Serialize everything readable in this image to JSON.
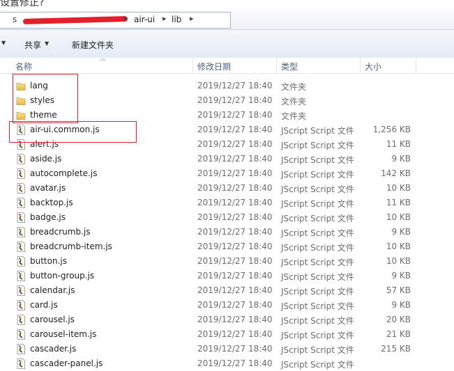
{
  "caption_partial": "设置修正?",
  "address": {
    "crumbs": [
      "air-ui",
      "lib"
    ],
    "separator": "▸"
  },
  "toolbar": {
    "share_label": "共享",
    "new_folder_label": "新建文件夹"
  },
  "columns": {
    "name": "名称",
    "date": "修改日期",
    "type": "类型",
    "size": "大小"
  },
  "files": [
    {
      "name": "lang",
      "date": "2019/12/27 18:40",
      "type": "文件夹",
      "size": "",
      "icon": "folder-icon"
    },
    {
      "name": "styles",
      "date": "2019/12/27 18:40",
      "type": "文件夹",
      "size": "",
      "icon": "folder-icon"
    },
    {
      "name": "theme",
      "date": "2019/12/27 18:40",
      "type": "文件夹",
      "size": "",
      "icon": "folder-icon"
    },
    {
      "name": "air-ui.common.js",
      "date": "2019/12/27 18:40",
      "type": "JScript Script 文件",
      "size": "1,256 KB",
      "icon": "jscript-file-icon"
    },
    {
      "name": "alert.js",
      "date": "2019/12/27 18:40",
      "type": "JScript Script 文件",
      "size": "11 KB",
      "icon": "jscript-file-icon"
    },
    {
      "name": "aside.js",
      "date": "2019/12/27 18:40",
      "type": "JScript Script 文件",
      "size": "9 KB",
      "icon": "jscript-file-icon"
    },
    {
      "name": "autocomplete.js",
      "date": "2019/12/27 18:40",
      "type": "JScript Script 文件",
      "size": "142 KB",
      "icon": "jscript-file-icon"
    },
    {
      "name": "avatar.js",
      "date": "2019/12/27 18:40",
      "type": "JScript Script 文件",
      "size": "10 KB",
      "icon": "jscript-file-icon"
    },
    {
      "name": "backtop.js",
      "date": "2019/12/27 18:40",
      "type": "JScript Script 文件",
      "size": "11 KB",
      "icon": "jscript-file-icon"
    },
    {
      "name": "badge.js",
      "date": "2019/12/27 18:40",
      "type": "JScript Script 文件",
      "size": "10 KB",
      "icon": "jscript-file-icon"
    },
    {
      "name": "breadcrumb.js",
      "date": "2019/12/27 18:40",
      "type": "JScript Script 文件",
      "size": "9 KB",
      "icon": "jscript-file-icon"
    },
    {
      "name": "breadcrumb-item.js",
      "date": "2019/12/27 18:40",
      "type": "JScript Script 文件",
      "size": "10 KB",
      "icon": "jscript-file-icon"
    },
    {
      "name": "button.js",
      "date": "2019/12/27 18:40",
      "type": "JScript Script 文件",
      "size": "10 KB",
      "icon": "jscript-file-icon"
    },
    {
      "name": "button-group.js",
      "date": "2019/12/27 18:40",
      "type": "JScript Script 文件",
      "size": "9 KB",
      "icon": "jscript-file-icon"
    },
    {
      "name": "calendar.js",
      "date": "2019/12/27 18:40",
      "type": "JScript Script 文件",
      "size": "57 KB",
      "icon": "jscript-file-icon"
    },
    {
      "name": "card.js",
      "date": "2019/12/27 18:40",
      "type": "JScript Script 文件",
      "size": "9 KB",
      "icon": "jscript-file-icon"
    },
    {
      "name": "carousel.js",
      "date": "2019/12/27 18:40",
      "type": "JScript Script 文件",
      "size": "20 KB",
      "icon": "jscript-file-icon"
    },
    {
      "name": "carousel-item.js",
      "date": "2019/12/27 18:40",
      "type": "JScript Script 文件",
      "size": "21 KB",
      "icon": "jscript-file-icon"
    },
    {
      "name": "cascader.js",
      "date": "2019/12/27 18:40",
      "type": "JScript Script 文件",
      "size": "215 KB",
      "icon": "jscript-file-icon"
    },
    {
      "name": "cascader-panel.js",
      "date": "2019/12/27 18:40",
      "type": "JScript Script 文件",
      "size": "",
      "icon": "jscript-file-icon"
    }
  ],
  "colors": {
    "annotation": "#e0202a",
    "redaction": "#e21f2a",
    "header_text": "#4c607a",
    "meta_text": "#6d6d6d"
  }
}
